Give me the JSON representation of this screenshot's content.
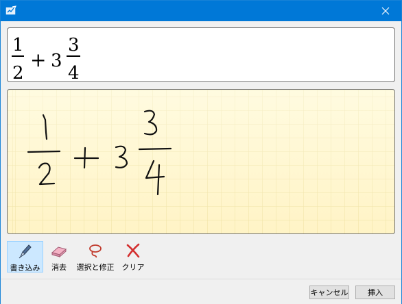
{
  "window": {
    "title": "",
    "accent": "#0078d7"
  },
  "titlebar": {
    "close_glyph": "✕",
    "app_icon": "math-input-icon"
  },
  "preview": {
    "num1": "1",
    "den1": "2",
    "plus": "+",
    "whole": "3",
    "num2": "3",
    "den2": "4"
  },
  "pad": {
    "ink": "1/2 + 3 3/4"
  },
  "toolbar": {
    "write_label": "書き込み",
    "erase_label": "消去",
    "select_label": "選択と修正",
    "clear_label": "クリア"
  },
  "footer": {
    "cancel_label": "キャンセル",
    "insert_label": "挿入"
  }
}
